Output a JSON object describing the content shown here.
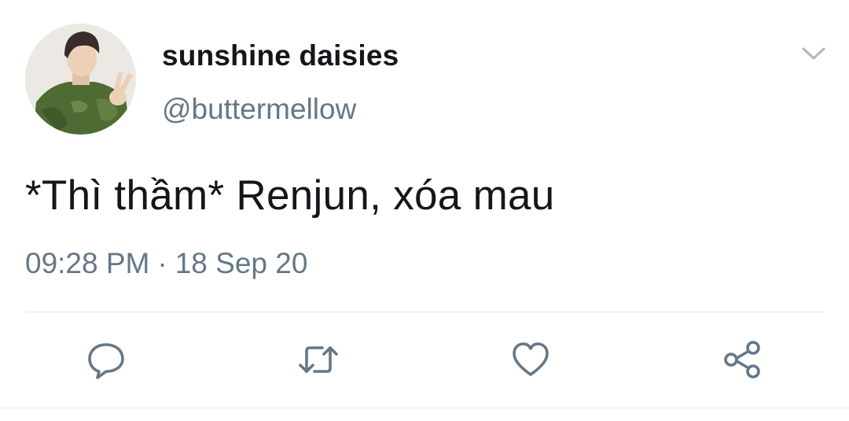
{
  "tweet": {
    "display_name": "sunshine daisies",
    "handle": "@buttermellow",
    "text": "*Thì thầm* Renjun, xóa mau",
    "time": "09:28 PM",
    "separator": "·",
    "date": "18 Sep 20"
  },
  "icons": {
    "more": "chevron-down-icon",
    "reply": "reply-icon",
    "retweet": "retweet-icon",
    "like": "heart-icon",
    "share": "share-icon"
  },
  "colors": {
    "text": "#14171a",
    "secondary": "#657786",
    "icon": "#657786",
    "divider": "#e1e8ed"
  }
}
